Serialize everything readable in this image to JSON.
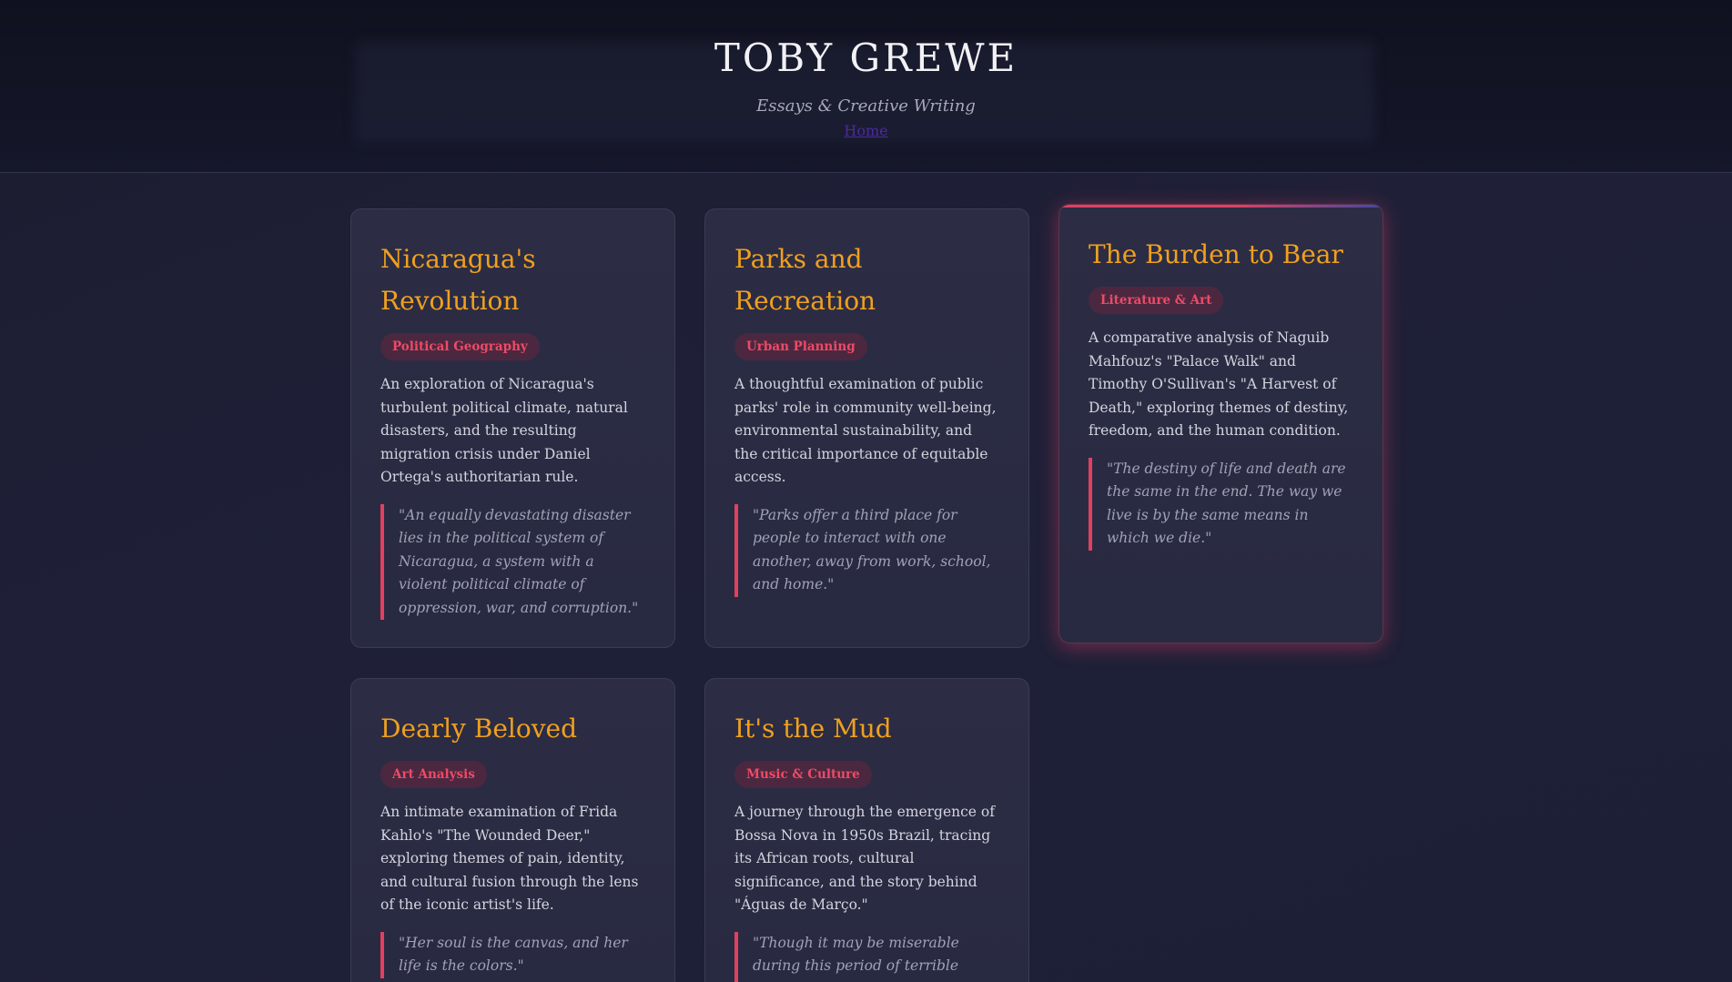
{
  "header": {
    "title": "TOBY GREWE",
    "subtitle": "Essays & Creative Writing",
    "nav_home": "Home"
  },
  "colors": {
    "accent_title": "#f0a01e",
    "accent_tag": "#ee4a66",
    "accent_quote_bar": "#e2405f",
    "link": "#4b2aa0"
  },
  "essays": [
    {
      "title": "Nicaragua's Revolution",
      "tag": "Political Geography",
      "description": "An exploration of Nicaragua's turbulent political climate, natural disasters, and the resulting migration crisis under Daniel Ortega's authoritarian rule.",
      "quote": "\"An equally devastating disaster lies in the political system of Nicaragua, a system with a violent political climate of oppression, war, and corruption.\""
    },
    {
      "title": "Parks and Recreation",
      "tag": "Urban Planning",
      "description": "A thoughtful examination of public parks' role in community well-being, environmental sustainability, and the critical importance of equitable access.",
      "quote": "\"Parks offer a third place for people to interact with one another, away from work, school, and home.\""
    },
    {
      "title": "The Burden to Bear",
      "tag": "Literature & Art",
      "description": "A comparative analysis of Naguib Mahfouz's \"Palace Walk\" and Timothy O'Sullivan's \"A Harvest of Death,\" exploring themes of destiny, freedom, and the human condition.",
      "quote": "\"The destiny of life and death are the same in the end. The way we live is by the same means in which we die.\""
    },
    {
      "title": "Dearly Beloved",
      "tag": "Art Analysis",
      "description": "An intimate examination of Frida Kahlo's \"The Wounded Deer,\" exploring themes of pain, identity, and cultural fusion through the lens of the iconic artist's life.",
      "quote": "\"Her soul is the canvas, and her life is the colors.\""
    },
    {
      "title": "It's the Mud",
      "tag": "Music & Culture",
      "description": "A journey through the emergence of Bossa Nova in 1950s Brazil, tracing its African roots, cultural significance, and the story behind \"Águas de Março.\"",
      "quote": "\"Though it may be miserable during this period of terrible rainfall, the rain washes more than mud; it"
    }
  ]
}
